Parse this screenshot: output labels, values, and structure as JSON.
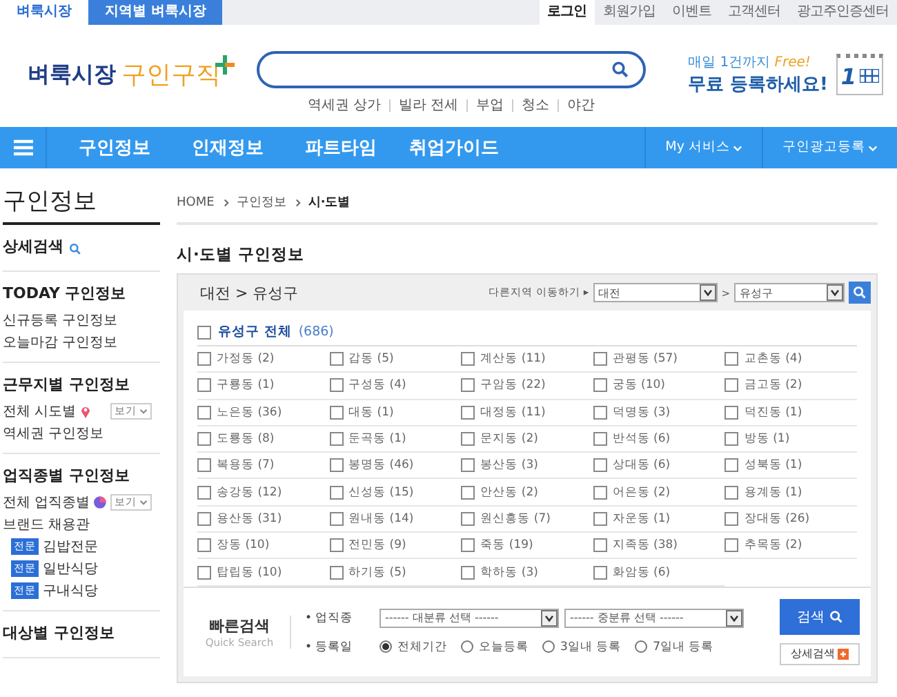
{
  "top_tabs": [
    {
      "label": "벼룩시장",
      "selected": true
    },
    {
      "label": "지역별 벼룩시장",
      "selected": false
    }
  ],
  "top_links": [
    {
      "label": "로그인",
      "selected": true
    },
    {
      "label": "회원가입",
      "selected": false
    },
    {
      "label": "이벤트",
      "selected": false
    },
    {
      "label": "고객센터",
      "selected": false
    },
    {
      "label": "광고주인증센터",
      "selected": false
    }
  ],
  "logo": {
    "brand": "벼룩시장",
    "service": "구인구직"
  },
  "search": {
    "keywords": [
      "역세권 상가",
      "빌라 전세",
      "부업",
      "청소",
      "야간"
    ]
  },
  "promo": {
    "line1": "매일 1건까지",
    "free": "Free!",
    "line2": "무료 등록하세요!",
    "badge": "1"
  },
  "nav": {
    "items": [
      "구인정보",
      "인재정보",
      "파트타임",
      "취업가이드"
    ],
    "right": [
      "My 서비스",
      "구인광고등록"
    ]
  },
  "sidebar": {
    "title": "구인정보",
    "detail_search": "상세검색",
    "sections": [
      {
        "title": "TODAY 구인정보",
        "links": [
          {
            "kind": "link",
            "label": "신규등록 구인정보"
          },
          {
            "kind": "link",
            "label": "오늘마감 구인정보"
          }
        ]
      },
      {
        "title": "근무지별 구인정보",
        "links": [
          {
            "kind": "location",
            "label": "전체 시도별",
            "view": "보기"
          },
          {
            "kind": "link",
            "label": "역세권 구인정보"
          }
        ]
      },
      {
        "title": "업직종별 구인정보",
        "links": [
          {
            "kind": "category",
            "label": "전체 업직종별",
            "view": "보기"
          },
          {
            "kind": "link",
            "label": "브랜드 채용관"
          },
          {
            "kind": "tag",
            "tag": "전문",
            "label": "김밥전문"
          },
          {
            "kind": "tag",
            "tag": "전문",
            "label": "일반식당"
          },
          {
            "kind": "tag",
            "tag": "전문",
            "label": "구내식당"
          }
        ]
      },
      {
        "title": "대상별 구인정보"
      }
    ]
  },
  "breadcrumb": [
    "HOME",
    "구인정보",
    "시·도별"
  ],
  "heading": "시·도별 구인정보",
  "region": {
    "path": "대전 > 유성구",
    "move_label": "다른지역 이동하기 ▸",
    "city": "대전",
    "sep": ">",
    "district": "유성구"
  },
  "all": {
    "label": "유성구 전체",
    "count": "(686)",
    "checked": false
  },
  "districts": [
    {
      "label": "가정동 (2)",
      "checked": false
    },
    {
      "label": "갑동 (5)",
      "checked": false
    },
    {
      "label": "계산동 (11)",
      "checked": false
    },
    {
      "label": "관평동 (57)",
      "checked": false
    },
    {
      "label": "교촌동 (4)",
      "checked": false
    },
    {
      "label": "구룡동 (1)",
      "checked": false
    },
    {
      "label": "구성동 (4)",
      "checked": false
    },
    {
      "label": "구암동 (22)",
      "checked": false
    },
    {
      "label": "궁동 (10)",
      "checked": false
    },
    {
      "label": "금고동 (2)",
      "checked": false
    },
    {
      "label": "노은동 (36)",
      "checked": false
    },
    {
      "label": "대동 (1)",
      "checked": false
    },
    {
      "label": "대정동 (11)",
      "checked": false
    },
    {
      "label": "덕명동 (3)",
      "checked": false
    },
    {
      "label": "덕진동 (1)",
      "checked": false
    },
    {
      "label": "도룡동 (8)",
      "checked": false
    },
    {
      "label": "둔곡동 (1)",
      "checked": false
    },
    {
      "label": "문지동 (2)",
      "checked": false
    },
    {
      "label": "반석동 (6)",
      "checked": false
    },
    {
      "label": "방동 (1)",
      "checked": false
    },
    {
      "label": "복용동 (7)",
      "checked": false
    },
    {
      "label": "봉명동 (46)",
      "checked": false
    },
    {
      "label": "봉산동 (3)",
      "checked": false
    },
    {
      "label": "상대동 (6)",
      "checked": false
    },
    {
      "label": "성북동 (1)",
      "checked": false
    },
    {
      "label": "송강동 (12)",
      "checked": false
    },
    {
      "label": "신성동 (15)",
      "checked": false
    },
    {
      "label": "안산동 (2)",
      "checked": false
    },
    {
      "label": "어은동 (2)",
      "checked": false
    },
    {
      "label": "용계동 (1)",
      "checked": false
    },
    {
      "label": "용산동 (31)",
      "checked": false
    },
    {
      "label": "원내동 (14)",
      "checked": false
    },
    {
      "label": "원신흥동 (7)",
      "checked": false
    },
    {
      "label": "자운동 (1)",
      "checked": false
    },
    {
      "label": "장대동 (26)",
      "checked": false
    },
    {
      "label": "장동 (10)",
      "checked": false
    },
    {
      "label": "전민동 (9)",
      "checked": false
    },
    {
      "label": "죽동 (19)",
      "checked": false
    },
    {
      "label": "지족동 (38)",
      "checked": false
    },
    {
      "label": "추목동 (2)",
      "checked": false
    },
    {
      "label": "탑립동 (10)",
      "checked": false
    },
    {
      "label": "하기동 (5)",
      "checked": false
    },
    {
      "label": "학하동 (3)",
      "checked": false
    },
    {
      "label": "화암동 (6)",
      "checked": false
    }
  ],
  "quick": {
    "title": "빠른검색",
    "subtitle": "Quick Search",
    "job_label": "• 업직종",
    "major": "------ 대분류 선택 ------",
    "minor": "------ 중분류 선택 ------",
    "date_label": "• 등록일",
    "periods": [
      {
        "label": "전체기간",
        "selected": true
      },
      {
        "label": "오늘등록",
        "selected": false
      },
      {
        "label": "3일내 등록",
        "selected": false
      },
      {
        "label": "7일내 등록",
        "selected": false
      }
    ],
    "search_button": "검색",
    "detail_button": "상세검색"
  }
}
